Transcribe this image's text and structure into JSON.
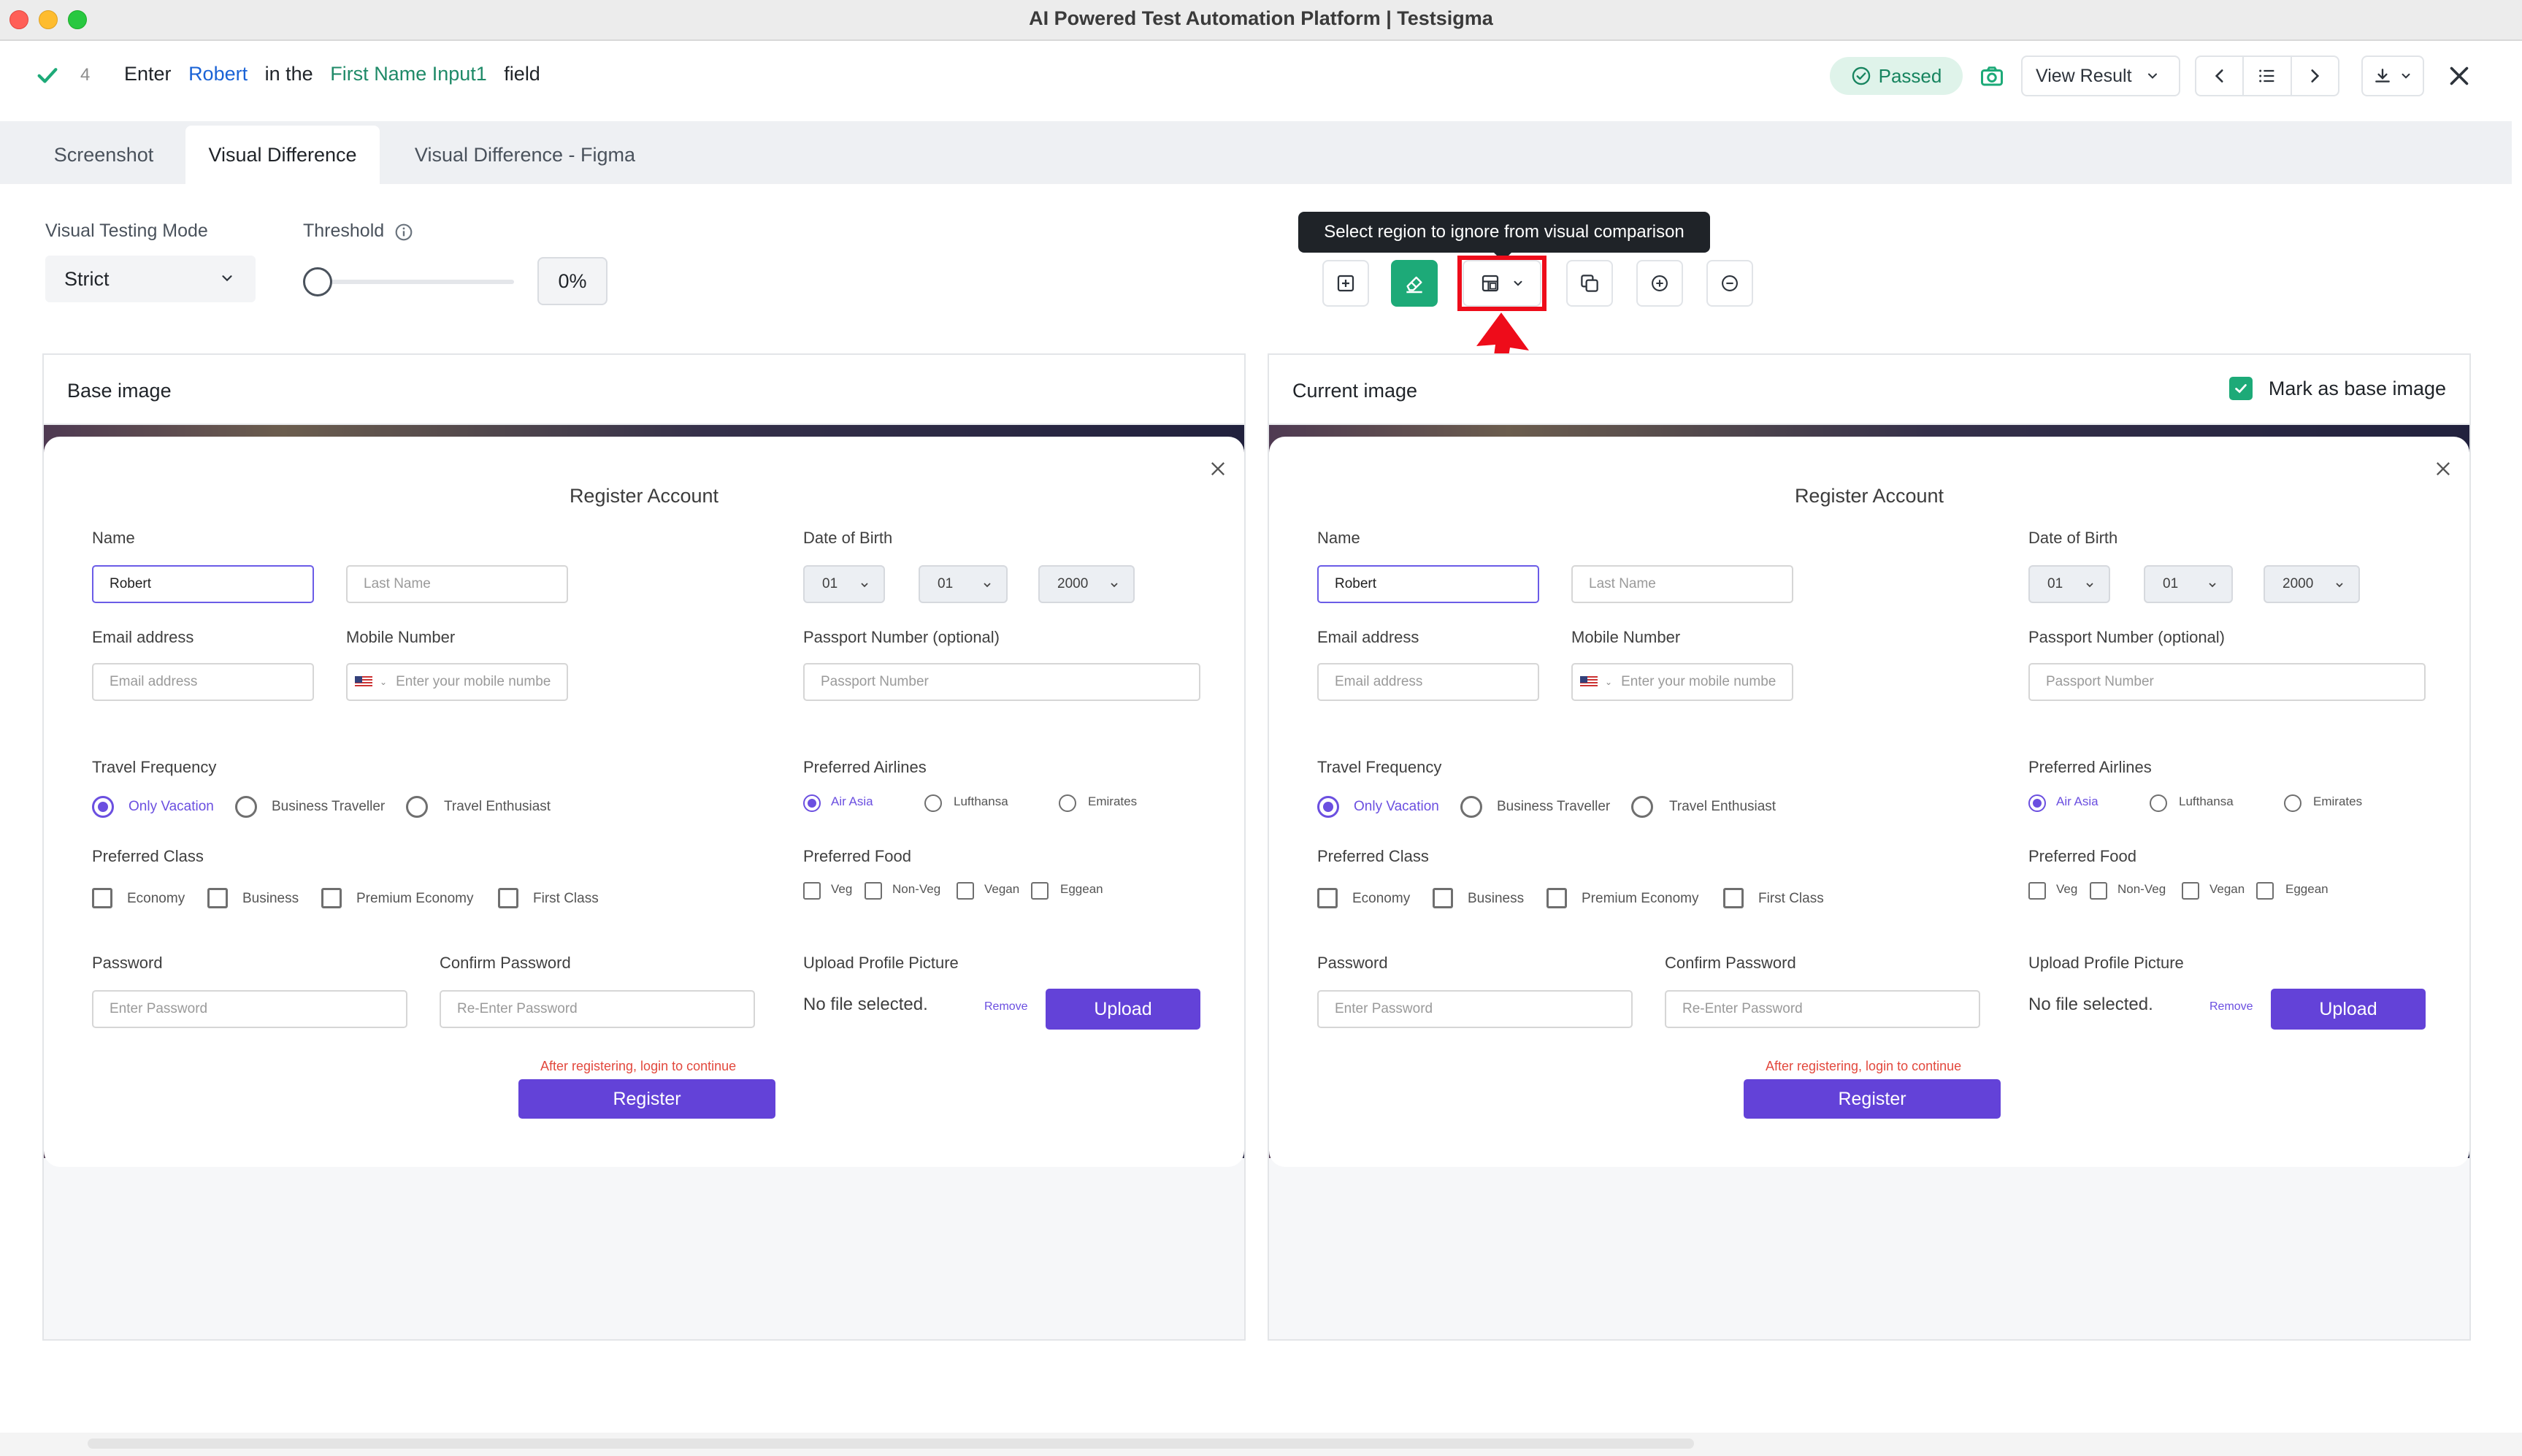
{
  "window": {
    "title": "AI Powered Test Automation Platform | Testsigma"
  },
  "step": {
    "number": "4",
    "words": [
      "Enter",
      "Robert",
      "in the",
      "First Name Input1",
      "field"
    ],
    "status": "Passed",
    "view_result": "View Result"
  },
  "tabs": [
    "Screenshot",
    "Visual Difference",
    "Visual Difference - Figma"
  ],
  "active_tab": "Visual Difference",
  "controls": {
    "mode_label": "Visual Testing Mode",
    "mode_value": "Strict",
    "threshold_label": "Threshold",
    "threshold_value": "0%",
    "tooltip": "Select region to ignore from visual comparison"
  },
  "tool_icons": [
    "crosshair-icon",
    "eraser-icon",
    "ignore-region-icon",
    "copy-region-icon",
    "zoom-in-icon",
    "zoom-out-icon"
  ],
  "colors": {
    "accent_green": "#1daa78",
    "form_purple": "#6342d8",
    "annotation_red": "#ee0c1a"
  },
  "base_panel": {
    "title": "Base image"
  },
  "current_panel": {
    "title": "Current image",
    "mark_base": "Mark as base image",
    "mark_base_checked": true
  },
  "form": {
    "title": "Register Account",
    "name_label": "Name",
    "first_name_value": "Robert",
    "last_name_placeholder": "Last Name",
    "dob_label": "Date of Birth",
    "dob_day": "01",
    "dob_month": "01",
    "dob_year": "2000",
    "email_label": "Email address",
    "email_placeholder": "Email address",
    "mobile_label": "Mobile Number",
    "mobile_placeholder": "Enter your mobile numbe",
    "passport_label": "Passport Number (optional)",
    "passport_placeholder": "Passport Number",
    "travel_label": "Travel Frequency",
    "travel_options": [
      "Only Vacation",
      "Business Traveller",
      "Travel Enthusiast"
    ],
    "airlines_label": "Preferred Airlines",
    "airline_options": [
      "Air Asia",
      "Lufthansa",
      "Emirates"
    ],
    "class_label": "Preferred Class",
    "class_options": [
      "Economy",
      "Business",
      "Premium Economy",
      "First Class"
    ],
    "food_label": "Preferred Food",
    "food_options": [
      "Veg",
      "Non-Veg",
      "Vegan",
      "Eggean"
    ],
    "password_label": "Password",
    "password_placeholder": "Enter Password",
    "confirm_label": "Confirm Password",
    "confirm_placeholder": "Re-Enter Password",
    "upload_label": "Upload Profile Picture",
    "no_file": "No file selected.",
    "remove": "Remove",
    "upload_button": "Upload",
    "hint": "After registering, login to continue",
    "register_button": "Register"
  }
}
